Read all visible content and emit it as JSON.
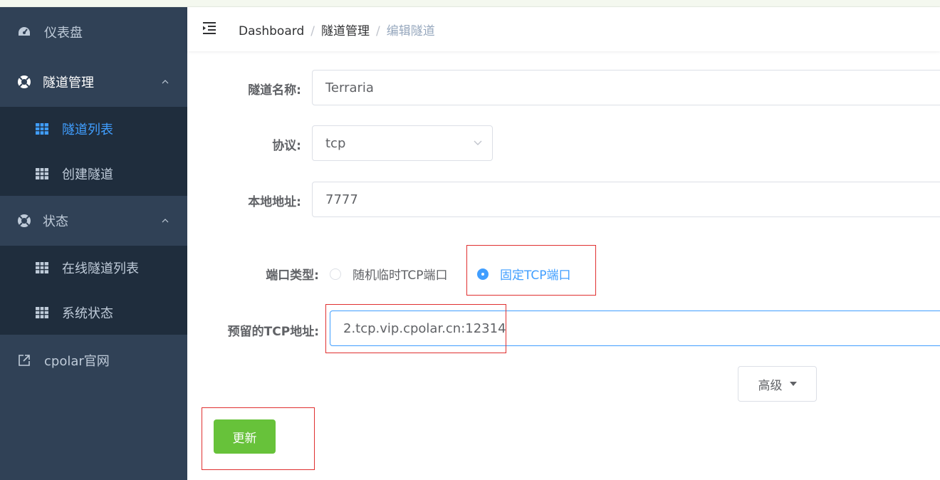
{
  "sidebar": {
    "items": [
      {
        "label": "仪表盘",
        "icon": "dashboard-icon"
      },
      {
        "label": "隧道管理",
        "icon": "lifebuoy-icon",
        "expanded": true,
        "children": [
          {
            "label": "隧道列表",
            "active": true
          },
          {
            "label": "创建隧道"
          }
        ]
      },
      {
        "label": "状态",
        "icon": "lifebuoy-icon",
        "expanded": true,
        "children": [
          {
            "label": "在线隧道列表"
          },
          {
            "label": "系统状态"
          }
        ]
      },
      {
        "label": "cpolar官网",
        "icon": "external-link-icon"
      }
    ]
  },
  "breadcrumb": {
    "items": [
      "Dashboard",
      "隧道管理",
      "编辑隧道"
    ]
  },
  "form": {
    "tunnel_name": {
      "label": "隧道名称:",
      "value": "Terraria"
    },
    "protocol": {
      "label": "协议:",
      "value": "tcp"
    },
    "local_address": {
      "label": "本地地址:",
      "value": "7777"
    },
    "port_type": {
      "label": "端口类型:",
      "options": [
        "随机临时TCP端口",
        "固定TCP端口"
      ],
      "selected": "固定TCP端口"
    },
    "reserved_tcp": {
      "label": "预留的TCP地址:",
      "value": "2.tcp.vip.cpolar.cn:12314"
    },
    "advanced_label": "高级",
    "update_label": "更新"
  },
  "colors": {
    "sidebar_bg": "#304156",
    "submenu_bg": "#1f2d3d",
    "active": "#409eff",
    "success": "#67c23a",
    "highlight_box": "#e03030"
  }
}
